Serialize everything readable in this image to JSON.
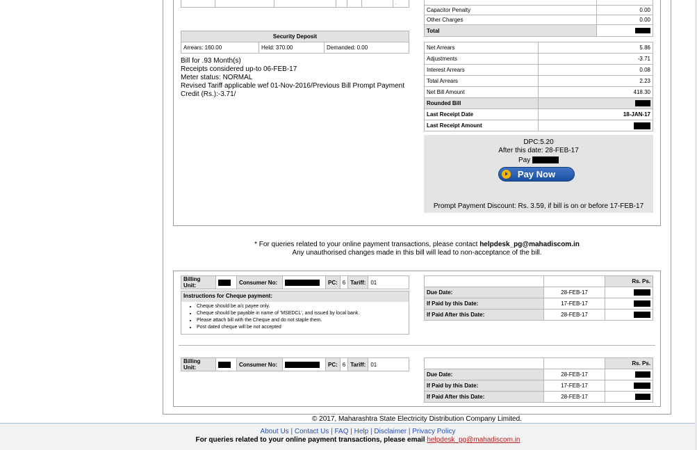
{
  "top_left_table": {
    "rows": 1
  },
  "charges": [
    {
      "label": "Capacitor Penalty",
      "value": "0.00"
    },
    {
      "label": "Other Charges",
      "value": "0.00"
    },
    {
      "label": "Total",
      "value": ""
    }
  ],
  "security_deposit": {
    "title": "Security Deposit",
    "arrears": "Arrears: 160.00",
    "held": "Held: 370.00",
    "demanded": "Demanded: 0.00"
  },
  "bill_info": [
    "Bill for .93 Month(s)",
    "Receipts considered up-to 06-FEB-17",
    "Meter status: NORMAL",
    "Revised Tariff applicable wef 01-Nov-2016/Previous Bill Prompt Payment",
    "Credit (Rs.):-3.71/"
  ],
  "summary": [
    {
      "label": "Net Arrears",
      "value": "5.86",
      "bold": false
    },
    {
      "label": "Adjustments",
      "value": "-3.71",
      "bold": false
    },
    {
      "label": "Interest Arrears",
      "value": "0.08",
      "bold": false
    },
    {
      "label": "Total Arrears",
      "value": "2.23",
      "bold": false
    },
    {
      "label": "Net Bill Amount",
      "value": "418.30",
      "bold": false
    },
    {
      "label": "Rounded Bill",
      "value": "",
      "bold": true
    },
    {
      "label": "Last Receipt Date",
      "value": "18-JAN-17",
      "bold": true
    },
    {
      "label": "Last Receipt Amount",
      "value": "",
      "bold": true
    }
  ],
  "payment_panel": {
    "dpc": "DPC:5.20",
    "after_date": "After this date: 28-FEB-17",
    "pay_label": "Pay",
    "pay_now_label": "Pay Now",
    "prompt_discount": "Prompt Payment Discount: Rs. 3.59, if bill is on or before 17-FEB-17"
  },
  "queries_note": {
    "prefix": "* For queries related to your online payment transactions, please contact ",
    "email": "helpdesk_pg@mahadiscom.in",
    "warning": "Any unauthorised changes made in this bill will lead to non-acceptance of the bill."
  },
  "slip": {
    "billing_unit_label": "Billing Unit:",
    "consumer_no_label": "Consumer No:",
    "pc_label": "PC:",
    "pc_value": "6",
    "tariff_label": "Tariff:",
    "tariff_value": "01",
    "cheque_title": "Instructions for Cheque payment:",
    "cheque_items": [
      "Cheque should be a/c payee only.",
      "Cheque should be payable in name of 'MSEDCL', and issued by local bank.",
      "Please attach bill with the Cheque and do not staple them.",
      "Post dated cheque will be not accepted"
    ],
    "rs_ps": "Rs. Ps.",
    "due_rows": [
      {
        "label": "Due Date:",
        "date": "28-FEB-17"
      },
      {
        "label": "If Paid by this Date:",
        "date": "17-FEB-17"
      },
      {
        "label": "If Paid After this Date:",
        "date": "28-FEB-17"
      }
    ]
  },
  "footer": {
    "copyright": "© 2017, Maharashtra State Electricity Distribution Company Limited.",
    "links": [
      "About Us",
      "Contact Us",
      "FAQ",
      "Help",
      "Disclaimer",
      "Privacy Policy"
    ],
    "queries_prefix": "For queries related to your online payment transactions, please email ",
    "email": "helpdesk_pg@mahadiscom.in"
  }
}
